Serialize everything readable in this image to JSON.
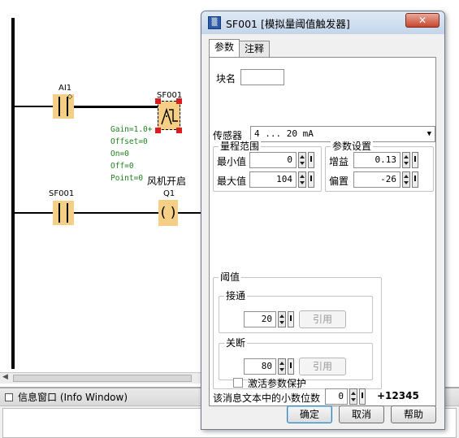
{
  "editor": {
    "blocks": [
      {
        "id": "contact-ai1",
        "label": "AI1"
      },
      {
        "id": "fb-sf001",
        "label": "SF001"
      },
      {
        "id": "contact-sf001",
        "label": "SF001"
      },
      {
        "id": "coil-q1",
        "label": "Q1",
        "symbol": "( )"
      }
    ],
    "fb_params": [
      "Gain=1.0+",
      "Offset=0",
      "On=0",
      "Off=0",
      "Point=0"
    ],
    "coil_comment": "风机开启"
  },
  "info_window": {
    "title": "信息窗口 (Info Window)"
  },
  "dialog": {
    "title": "SF001 [模拟量阈值触发器]",
    "close_label": "✕",
    "tabs": [
      "参数",
      "注释"
    ],
    "block_name_label": "块名",
    "block_name_value": "",
    "sensor_label": "传感器",
    "sensor_value": "4 ... 20 mA",
    "range_group": {
      "legend": "量程范围",
      "min_label": "最小值",
      "min_value": "0",
      "max_label": "最大值",
      "max_value": "104"
    },
    "param_group": {
      "legend": "参数设置",
      "gain_label": "增益",
      "gain_value": "0.13",
      "offset_label": "偏置",
      "offset_value": "-26"
    },
    "threshold_group": {
      "legend": "阈值",
      "on_legend": "接通",
      "on_value": "20",
      "on_ref_label": "引用",
      "off_legend": "关断",
      "off_value": "80",
      "off_ref_label": "引用"
    },
    "decimal_label": "该消息文本中的小数位数",
    "decimal_value": "0",
    "decimal_preview": "+12345",
    "protect_label": "激活参数保护",
    "protect_checked": false,
    "buttons": {
      "ok": "确定",
      "cancel": "取消",
      "help": "帮助"
    }
  }
}
